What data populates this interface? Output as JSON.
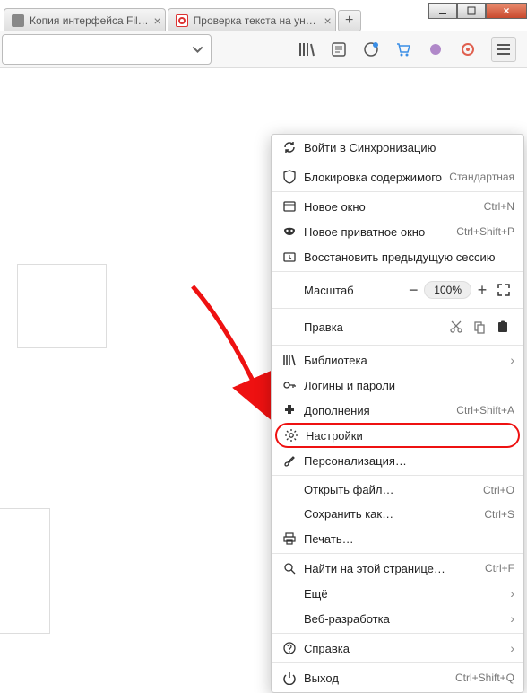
{
  "window": {
    "close_glyph": "×"
  },
  "tabs": {
    "t0_label": "Копия интерфейса Fil…",
    "t1_label": "Проверка текста на уник…",
    "new_glyph": "+"
  },
  "menu": {
    "sync": "Войти в Синхронизацию",
    "content_block": "Блокировка содержимого",
    "content_block_status": "Стандартная",
    "new_window": "Новое окно",
    "new_window_sc": "Ctrl+N",
    "new_private": "Новое приватное окно",
    "new_private_sc": "Ctrl+Shift+P",
    "restore": "Восстановить предыдущую сессию",
    "zoom_label": "Масштаб",
    "zoom_value": "100%",
    "zoom_minus": "−",
    "zoom_plus": "+",
    "edit_label": "Правка",
    "library": "Библиотека",
    "logins": "Логины и пароли",
    "addons": "Дополнения",
    "addons_sc": "Ctrl+Shift+A",
    "settings": "Настройки",
    "customize": "Персонализация…",
    "open_file": "Открыть файл…",
    "open_file_sc": "Ctrl+O",
    "save_as": "Сохранить как…",
    "save_as_sc": "Ctrl+S",
    "print": "Печать…",
    "find": "Найти на этой странице…",
    "find_sc": "Ctrl+F",
    "more": "Ещё",
    "webdev": "Веб-разработка",
    "help": "Справка",
    "exit": "Выход",
    "exit_sc": "Ctrl+Shift+Q"
  }
}
